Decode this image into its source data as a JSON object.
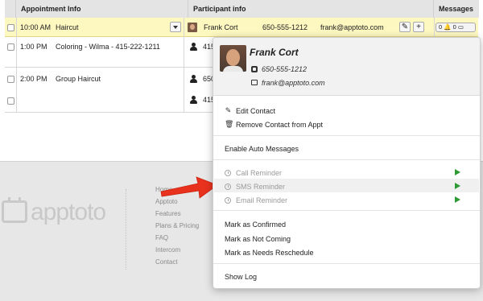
{
  "table": {
    "headers": {
      "appointment": "Appointment Info",
      "participant": "Participant info",
      "messages": "Messages"
    },
    "rows": [
      {
        "time": "10:00 AM",
        "title": "Haircut",
        "name": "Frank Cort",
        "phone": "650-555-1212",
        "email": "frank@apptoto.com",
        "msg_counts": "0 🔔 0 ▭"
      },
      {
        "time": "1:00 PM",
        "title": "Coloring - Wilma - 415-222-1211",
        "participant_partial": "415"
      },
      {
        "time": "2:00 PM",
        "title": "Group Haircut",
        "participant_partial": "650"
      },
      {
        "participant_partial": "415"
      }
    ],
    "edit_icon": "pencil-icon",
    "add_label": "+"
  },
  "popover": {
    "name": "Frank Cort",
    "phone": "650-555-1212",
    "email": "frank@apptoto.com",
    "menu": {
      "edit_contact": "Edit Contact",
      "remove_contact": "Remove Contact from Appt",
      "enable_auto": "Enable Auto Messages",
      "call_reminder": "Call Reminder",
      "sms_reminder": "SMS Reminder",
      "email_reminder": "Email Reminder",
      "mark_confirmed": "Mark as Confirmed",
      "mark_not_coming": "Mark as Not Coming",
      "mark_reschedule": "Mark as Needs Reschedule",
      "show_log": "Show Log"
    },
    "icons": {
      "edit": "pencil-icon",
      "remove": "trash-icon",
      "reminder": "clock-icon",
      "send": "play-icon"
    },
    "colors": {
      "send": "#2d9a34"
    }
  },
  "footer": {
    "logo": "apptoto",
    "links": [
      "Home",
      "Apptoto",
      "Features",
      "Plans & Pricing",
      "FAQ",
      "Intercom",
      "Contact"
    ]
  },
  "annotation": {
    "arrow_color": "#e8321e"
  },
  "colors": {
    "selected_row": "#fdf7c0",
    "header_bg": "#e4e4e4"
  }
}
